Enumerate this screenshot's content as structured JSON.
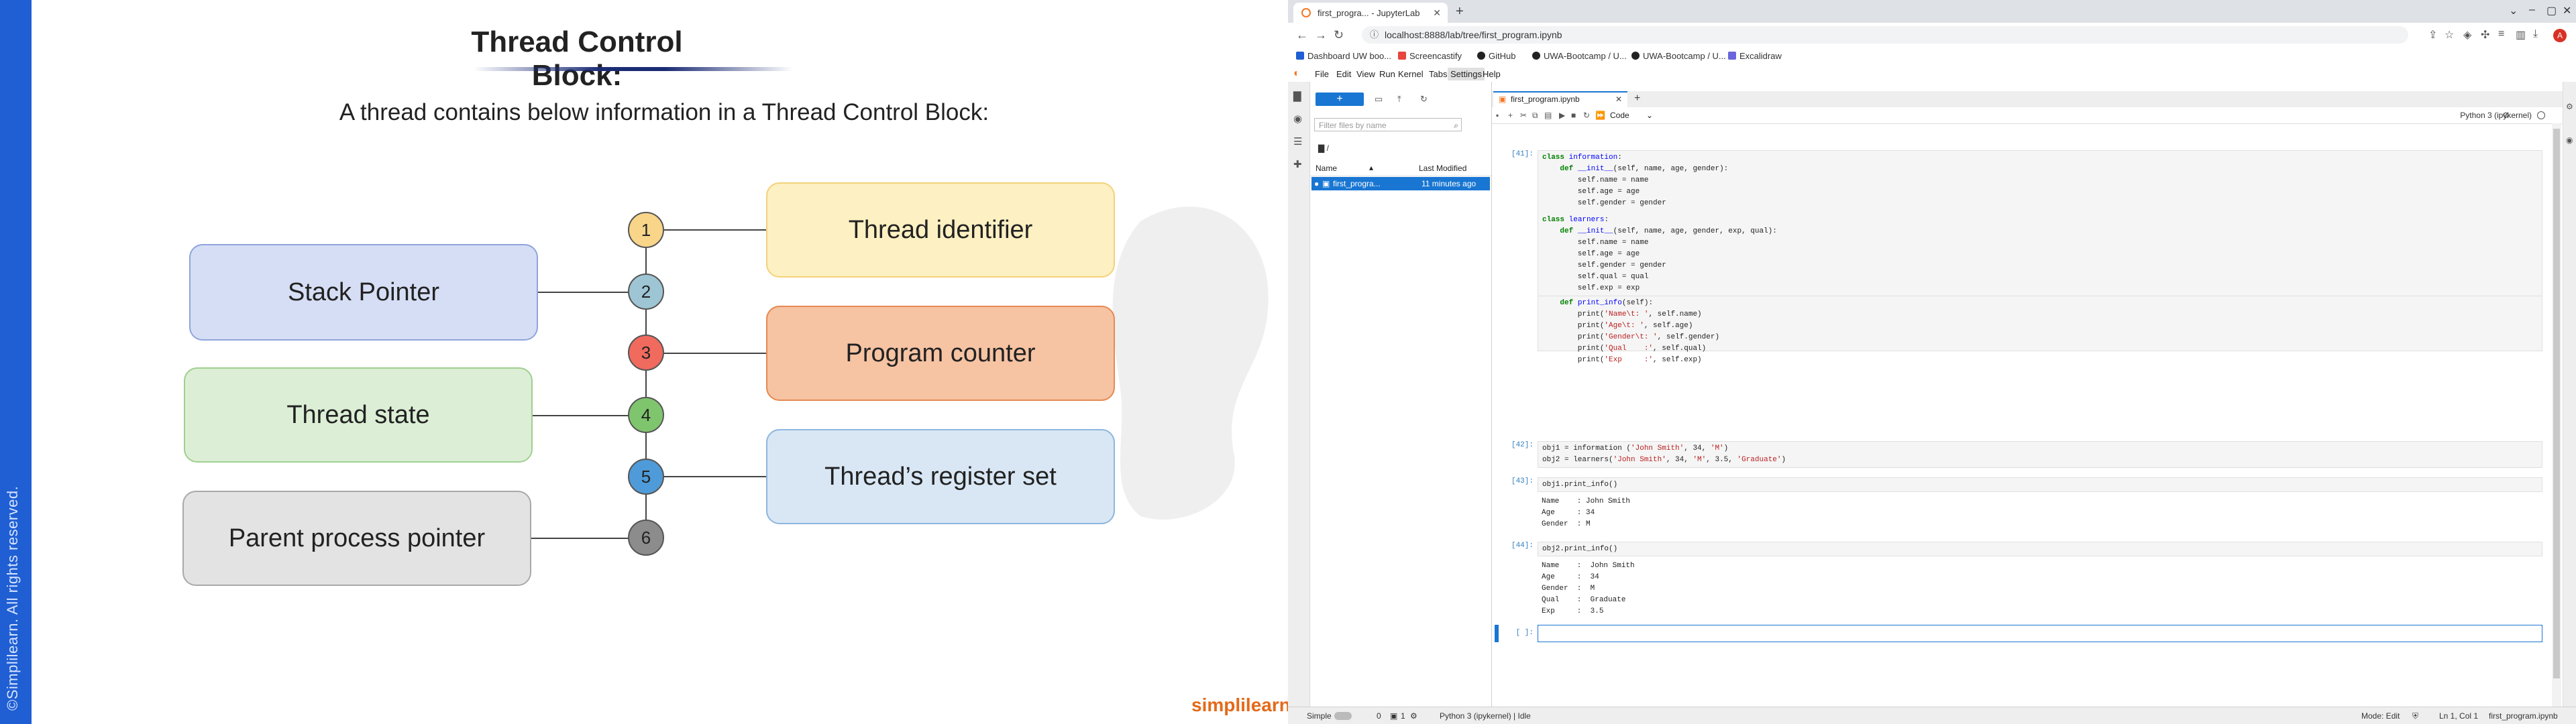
{
  "slide": {
    "title": "Thread Control Block:",
    "subtitle": "A thread contains below information in a Thread Control Block:",
    "copyright": "©Simplilearn. All rights reserved.",
    "logo": "simplilearn",
    "items": [
      {
        "number": "1",
        "label": "Thread identifier",
        "color": "#fdf0c2",
        "border": "#f3d27a",
        "circle": "#f9d58a"
      },
      {
        "number": "2",
        "label": "Stack Pointer",
        "color": "#d6def5",
        "border": "#8fa4dc",
        "circle": "#9ec5d4"
      },
      {
        "number": "3",
        "label": "Program counter",
        "color": "#f6c3a3",
        "border": "#e58a52",
        "circle": "#f06a5e"
      },
      {
        "number": "4",
        "label": "Thread state",
        "color": "#dcefd6",
        "border": "#9fcf8e",
        "circle": "#7fc56d"
      },
      {
        "number": "5",
        "label": "Thread’s register set",
        "color": "#d9e7f5",
        "border": "#8eb6dd",
        "circle": "#4f9bd9"
      },
      {
        "number": "6",
        "label": "Parent process pointer",
        "color": "#e3e3e3",
        "border": "#a9a9a9",
        "circle": "#8c8c8c"
      }
    ]
  },
  "browser": {
    "tab_title": "first_progra... - JupyterLab",
    "url": "localhost:8888/lab/tree/first_program.ipynb",
    "bookmarks": [
      "Dashboard UW boo...",
      "Screencastify",
      "GitHub",
      "UWA-Bootcamp / U...",
      "UWA-Bootcamp / U...",
      "Excalidraw"
    ],
    "avatar": "A"
  },
  "jupyter": {
    "menu": [
      "File",
      "Edit",
      "View",
      "Run",
      "Kernel",
      "Tabs",
      "Settings",
      "Help"
    ],
    "filter_placeholder": "Filter files by name",
    "breadcrumb": "/",
    "col_name": "Name",
    "col_modified": "Last Modified",
    "file_name": "first_progra...",
    "file_modified": "11 minutes ago",
    "notebook_tab": "first_program.ipynb",
    "cell_type": "Code",
    "kernel": "Python 3 (ipykernel)",
    "prompts": {
      "c41": "[41]:",
      "c42": "[42]:",
      "c43": "[43]:",
      "c44": "[44]:",
      "c_empty": "[ ]:"
    },
    "output_43": "Name    : John Smith\nAge     : 34\nGender  : M",
    "output_44": "Name    :  John Smith\nAge     :  34\nGender  :  M\nQual    :  Graduate\nExp     :  3.5"
  },
  "status": {
    "mode_label": "Simple",
    "counts_a": "0",
    "counts_b": "1",
    "kernel_status": "Python 3 (ipykernel) | Idle",
    "mode": "Mode: Edit",
    "position": "Ln 1, Col 1",
    "file": "first_program.ipynb"
  }
}
